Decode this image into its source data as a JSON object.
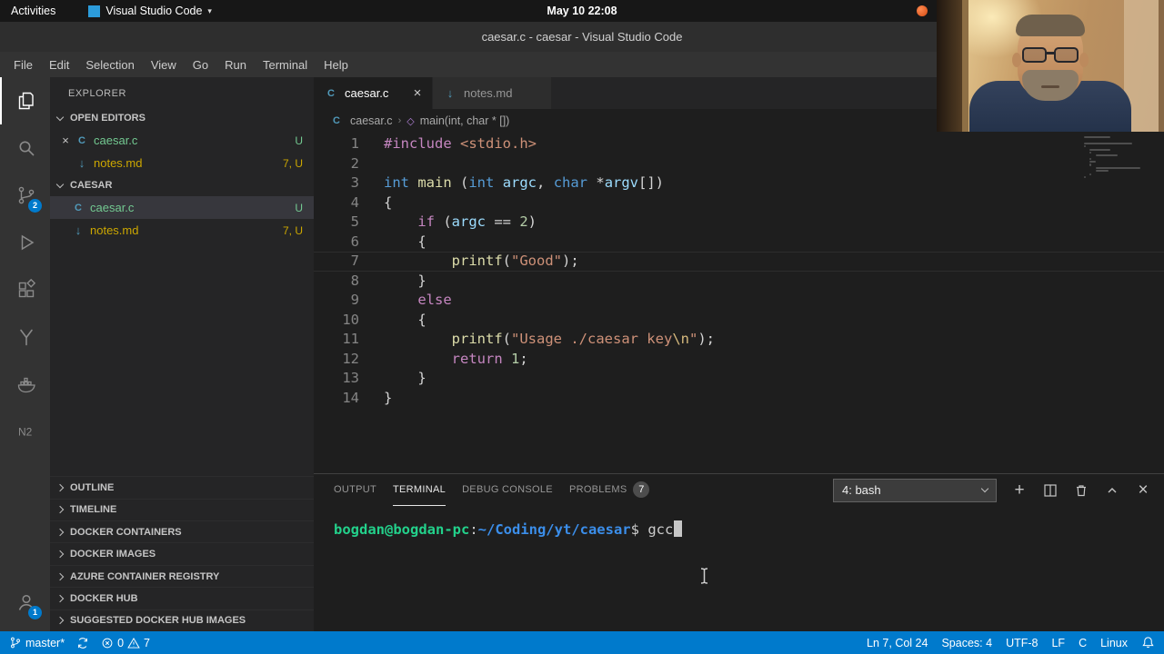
{
  "gnome_bar": {
    "activities": "Activities",
    "app_menu": "Visual Studio Code",
    "clock": "May 10  22:08"
  },
  "titlebar": {
    "title": "caesar.c - caesar - Visual Studio Code"
  },
  "menubar": {
    "items": [
      "File",
      "Edit",
      "Selection",
      "View",
      "Go",
      "Run",
      "Terminal",
      "Help"
    ]
  },
  "activity_bar": {
    "source_control_badge": "2",
    "accounts_badge": "1"
  },
  "sidebar": {
    "title": "EXPLORER",
    "open_editors_header": "OPEN EDITORS",
    "open_editors": [
      {
        "label": "caesar.c",
        "icon": "c",
        "badge": "U",
        "status": "untracked",
        "close": "×"
      },
      {
        "label": "notes.md",
        "icon": "md",
        "badge": "7, U",
        "status": "warning",
        "close": ""
      }
    ],
    "project_header": "CAESAR",
    "project_files": [
      {
        "label": "caesar.c",
        "icon": "c",
        "badge": "U",
        "status": "untracked",
        "selected": true
      },
      {
        "label": "notes.md",
        "icon": "md",
        "badge": "7, U",
        "status": "warning",
        "selected": false
      }
    ],
    "sections": [
      "OUTLINE",
      "TIMELINE",
      "DOCKER CONTAINERS",
      "DOCKER IMAGES",
      "AZURE CONTAINER REGISTRY",
      "DOCKER HUB",
      "SUGGESTED DOCKER HUB IMAGES"
    ]
  },
  "editor": {
    "tabs": [
      {
        "label": "caesar.c",
        "icon": "c",
        "active": true,
        "close": "×"
      },
      {
        "label": "notes.md",
        "icon": "md",
        "active": false,
        "close": ""
      }
    ],
    "breadcrumb": {
      "file": "caesar.c",
      "symbol": "main(int, char * [])"
    },
    "current_line": 7,
    "code_lines": [
      [
        {
          "c": "kw",
          "t": "#include"
        },
        {
          "c": "pn",
          "t": " "
        },
        {
          "c": "str",
          "t": "<stdio.h>"
        }
      ],
      [],
      [
        {
          "c": "type",
          "t": "int"
        },
        {
          "c": "pn",
          "t": " "
        },
        {
          "c": "fn",
          "t": "main"
        },
        {
          "c": "pn",
          "t": " ("
        },
        {
          "c": "type",
          "t": "int"
        },
        {
          "c": "pn",
          "t": " "
        },
        {
          "c": "var",
          "t": "argc"
        },
        {
          "c": "pn",
          "t": ", "
        },
        {
          "c": "type",
          "t": "char"
        },
        {
          "c": "pn",
          "t": " *"
        },
        {
          "c": "var",
          "t": "argv"
        },
        {
          "c": "pn",
          "t": "[])"
        }
      ],
      [
        {
          "c": "pn",
          "t": "{"
        }
      ],
      [
        {
          "c": "pn",
          "t": "    "
        },
        {
          "c": "kw",
          "t": "if"
        },
        {
          "c": "pn",
          "t": " ("
        },
        {
          "c": "var",
          "t": "argc"
        },
        {
          "c": "pn",
          "t": " == "
        },
        {
          "c": "num",
          "t": "2"
        },
        {
          "c": "pn",
          "t": ")"
        }
      ],
      [
        {
          "c": "pn",
          "t": "    {"
        }
      ],
      [
        {
          "c": "pn",
          "t": "        "
        },
        {
          "c": "fn",
          "t": "printf"
        },
        {
          "c": "pn",
          "t": "("
        },
        {
          "c": "str",
          "t": "\"Good\""
        },
        {
          "c": "pn",
          "t": ");"
        }
      ],
      [
        {
          "c": "pn",
          "t": "    }"
        }
      ],
      [
        {
          "c": "pn",
          "t": "    "
        },
        {
          "c": "kw",
          "t": "else"
        }
      ],
      [
        {
          "c": "pn",
          "t": "    {"
        }
      ],
      [
        {
          "c": "pn",
          "t": "        "
        },
        {
          "c": "fn",
          "t": "printf"
        },
        {
          "c": "pn",
          "t": "("
        },
        {
          "c": "str",
          "t": "\"Usage ./caesar key"
        },
        {
          "c": "esc",
          "t": "\\n"
        },
        {
          "c": "str",
          "t": "\""
        },
        {
          "c": "pn",
          "t": ");"
        }
      ],
      [
        {
          "c": "pn",
          "t": "        "
        },
        {
          "c": "kw",
          "t": "return"
        },
        {
          "c": "pn",
          "t": " "
        },
        {
          "c": "num",
          "t": "1"
        },
        {
          "c": "pn",
          "t": ";"
        }
      ],
      [
        {
          "c": "pn",
          "t": "    }"
        }
      ],
      [
        {
          "c": "pn",
          "t": "}"
        }
      ]
    ]
  },
  "panel": {
    "tabs": [
      {
        "label": "OUTPUT",
        "active": false,
        "badge": ""
      },
      {
        "label": "TERMINAL",
        "active": true,
        "badge": ""
      },
      {
        "label": "DEBUG CONSOLE",
        "active": false,
        "badge": ""
      },
      {
        "label": "PROBLEMS",
        "active": false,
        "badge": "7"
      }
    ],
    "terminal_select": "4: bash",
    "terminal": {
      "user": "bogdan@bogdan-pc",
      "separator": ":",
      "path": "~/Coding/yt/caesar",
      "prompt_symbol": "$ ",
      "command": "gcc"
    }
  },
  "status_bar": {
    "branch": "master*",
    "errors": "0",
    "warnings": "7",
    "line_col": "Ln 7, Col 24",
    "indent": "Spaces: 4",
    "encoding": "UTF-8",
    "eol": "LF",
    "language": "C",
    "os": "Linux"
  },
  "colors": {
    "accent": "#007acc",
    "untracked": "#73c991",
    "warning": "#cca700"
  }
}
